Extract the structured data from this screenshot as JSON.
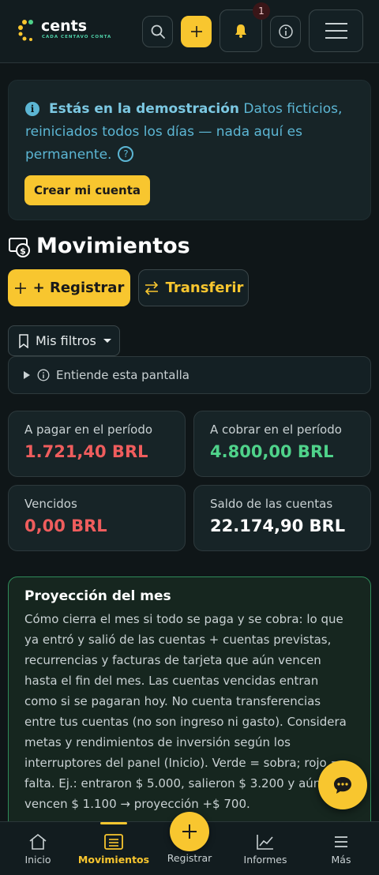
{
  "app": {
    "name": "cents",
    "tagline": "CADA CENTAVO CONTA",
    "notification_count": "1",
    "colors": {
      "accent": "#f8c62f",
      "background": "#0f1618",
      "info": "#5cb6d4",
      "negative": "#ef5d5d",
      "positive": "#4fd28a"
    }
  },
  "header": {
    "search_icon": "search-icon",
    "add_icon": "plus-icon",
    "bell_icon": "bell-icon",
    "info_icon": "info-icon",
    "menu_icon": "hamburger-icon"
  },
  "banner": {
    "bold": "Estás en la demostración",
    "text": " Datos ficticios, reiniciados todos los días — nada aquí es permanente.",
    "cta": "Crear mi cuenta"
  },
  "page": {
    "title": "Movimientos",
    "register_label": "+ Registrar",
    "transfer_label": "Transferir",
    "filters_label": "Mis filtros",
    "help_label": "Entiende esta pantalla"
  },
  "stats": [
    {
      "label": "A pagar en el período",
      "value": "1.721,40 BRL",
      "tone": "negative"
    },
    {
      "label": "A cobrar en el período",
      "value": "4.800,00 BRL",
      "tone": "positive"
    },
    {
      "label": "Vencidos",
      "value": "0,00 BRL",
      "tone": "negative"
    },
    {
      "label": "Saldo de las cuentas",
      "value": "22.174,90 BRL",
      "tone": "neutral"
    }
  ],
  "projection": {
    "title": "Proyección del mes",
    "body": "Cómo cierra el mes si todo se paga y se cobra: lo que ya entró y salió de las cuentas + cuentas previstas, recurrencias y facturas de tarjeta que aún vencen hasta el fin del mes. Las cuentas vencidas entran como si se pagaran hoy. No cuenta transferencias entre tus cuentas (no son ingreso ni gasto). Considera metas y rendimientos de inversión según los interruptores del panel (Inicio). Verde = sobra; rojo = falta. Ej.: entraron $ 5.000, salieron $ 3.200 y aún vencen $ 1.100 → proyección +$ 700."
  },
  "bottom_nav": {
    "items": [
      {
        "label": "Inicio",
        "icon": "home-icon"
      },
      {
        "label": "Movimientos",
        "icon": "list-icon",
        "active": true
      },
      {
        "label": "Registrar",
        "icon": "plus-icon"
      },
      {
        "label": "Informes",
        "icon": "chart-icon"
      },
      {
        "label": "Más",
        "icon": "menu-icon"
      }
    ]
  }
}
